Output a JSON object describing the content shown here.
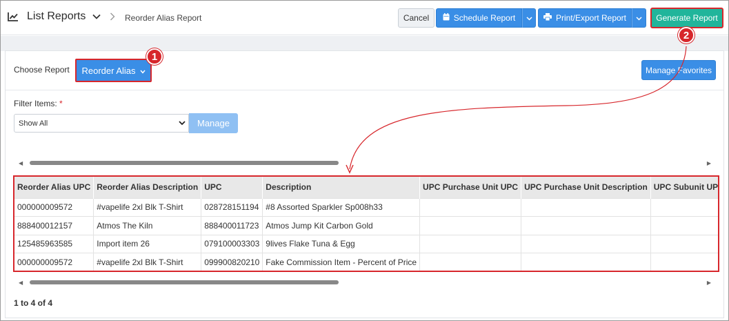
{
  "header": {
    "title": "List Reports",
    "breadcrumb": "Reorder Alias Report",
    "cancel_label": "Cancel",
    "schedule_label": "Schedule Report",
    "print_label": "Print/Export Report",
    "generate_label": "Generate Report"
  },
  "controls": {
    "choose_label": "Choose Report",
    "report_value": "Reorder Alias",
    "favorites_label": "Manage Favorites",
    "filter_label": "Filter Items:",
    "filter_required": "*",
    "filter_value": "Show All",
    "manage_label": "Manage"
  },
  "table": {
    "columns": [
      "Reorder Alias UPC",
      "Reorder Alias Description",
      "UPC",
      "Description",
      "UPC Purchase Unit UPC",
      "UPC Purchase Unit Description",
      "UPC Subunit UPC"
    ],
    "rows": [
      [
        "000000009572",
        "#vapelife 2xl Blk T-Shirt",
        "028728151194",
        "#8 Assorted Sparkler Sp008h33",
        "",
        "",
        ""
      ],
      [
        "888400012157",
        "Atmos The Kiln",
        "888400011723",
        "Atmos Jump Kit Carbon Gold",
        "",
        "",
        ""
      ],
      [
        "125485963585",
        "Import item 26",
        "079100003303",
        "9lives Flake Tuna & Egg",
        "",
        "",
        ""
      ],
      [
        "000000009572",
        "#vapelife 2xl Blk T-Shirt",
        "099900820210",
        "Fake Commission Item - Percent of Price",
        "",
        "",
        ""
      ]
    ]
  },
  "paging": "1 to 4 of 4",
  "callouts": [
    "1",
    "2"
  ],
  "colors": {
    "accent_blue": "#3a8ee6",
    "generate_green": "#21b59b",
    "highlight_red": "#d7262b"
  }
}
